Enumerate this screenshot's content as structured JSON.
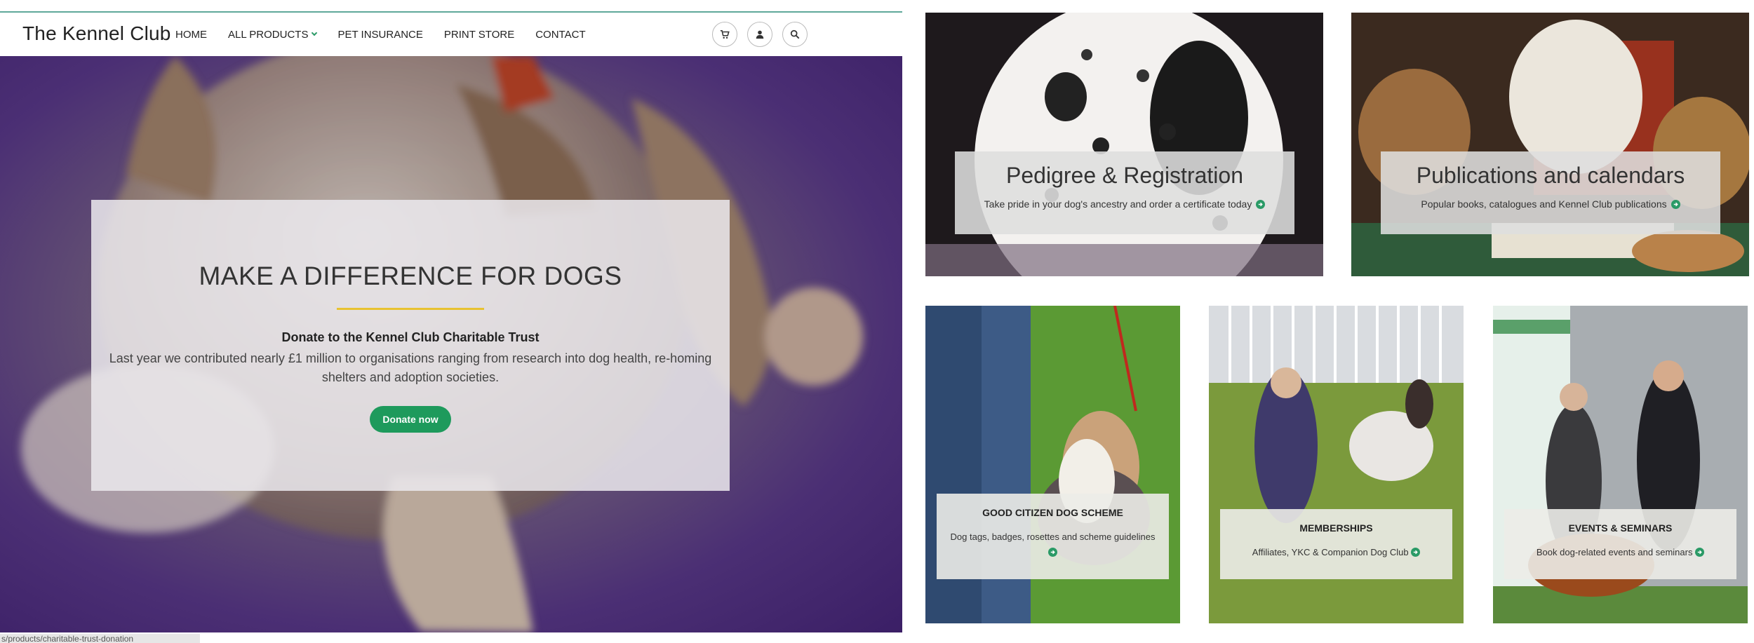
{
  "header": {
    "logo": "The Kennel Club",
    "nav": [
      {
        "label": "HOME"
      },
      {
        "label": "ALL PRODUCTS",
        "has_dropdown": true
      },
      {
        "label": "PET INSURANCE"
      },
      {
        "label": "PRINT STORE"
      },
      {
        "label": "CONTACT"
      }
    ],
    "icons": [
      "cart-icon",
      "user-icon",
      "search-icon"
    ]
  },
  "hero": {
    "title": "MAKE A DIFFERENCE FOR DOGS",
    "subtitle": "Donate to the Kennel Club Charitable Trust",
    "text": "Last year we contributed nearly £1 million to organisations ranging from research into dog health, re-homing shelters and adoption societies.",
    "button": "Donate now"
  },
  "status_bar_url": "s/products/charitable-trust-donation",
  "tiles": {
    "pedigree": {
      "title": "Pedigree & Registration",
      "desc": "Take pride in your dog's ancestry and order a certificate today"
    },
    "publications": {
      "title": "Publications and calendars",
      "desc": "Popular books, catalogues and Kennel Club publications"
    },
    "good_citizen": {
      "title": "GOOD CITIZEN DOG SCHEME",
      "desc": "Dog tags, badges, rosettes and scheme guidelines"
    },
    "memberships": {
      "title": "MEMBERSHIPS",
      "desc": "Affiliates, YKC & Companion Dog Club"
    },
    "events": {
      "title": "EVENTS & SEMINARS",
      "desc": "Book dog-related events and seminars"
    }
  },
  "colors": {
    "accent_green": "#1e9a5c",
    "rule_yellow": "#e8c231",
    "top_line": "#5fa89a"
  }
}
